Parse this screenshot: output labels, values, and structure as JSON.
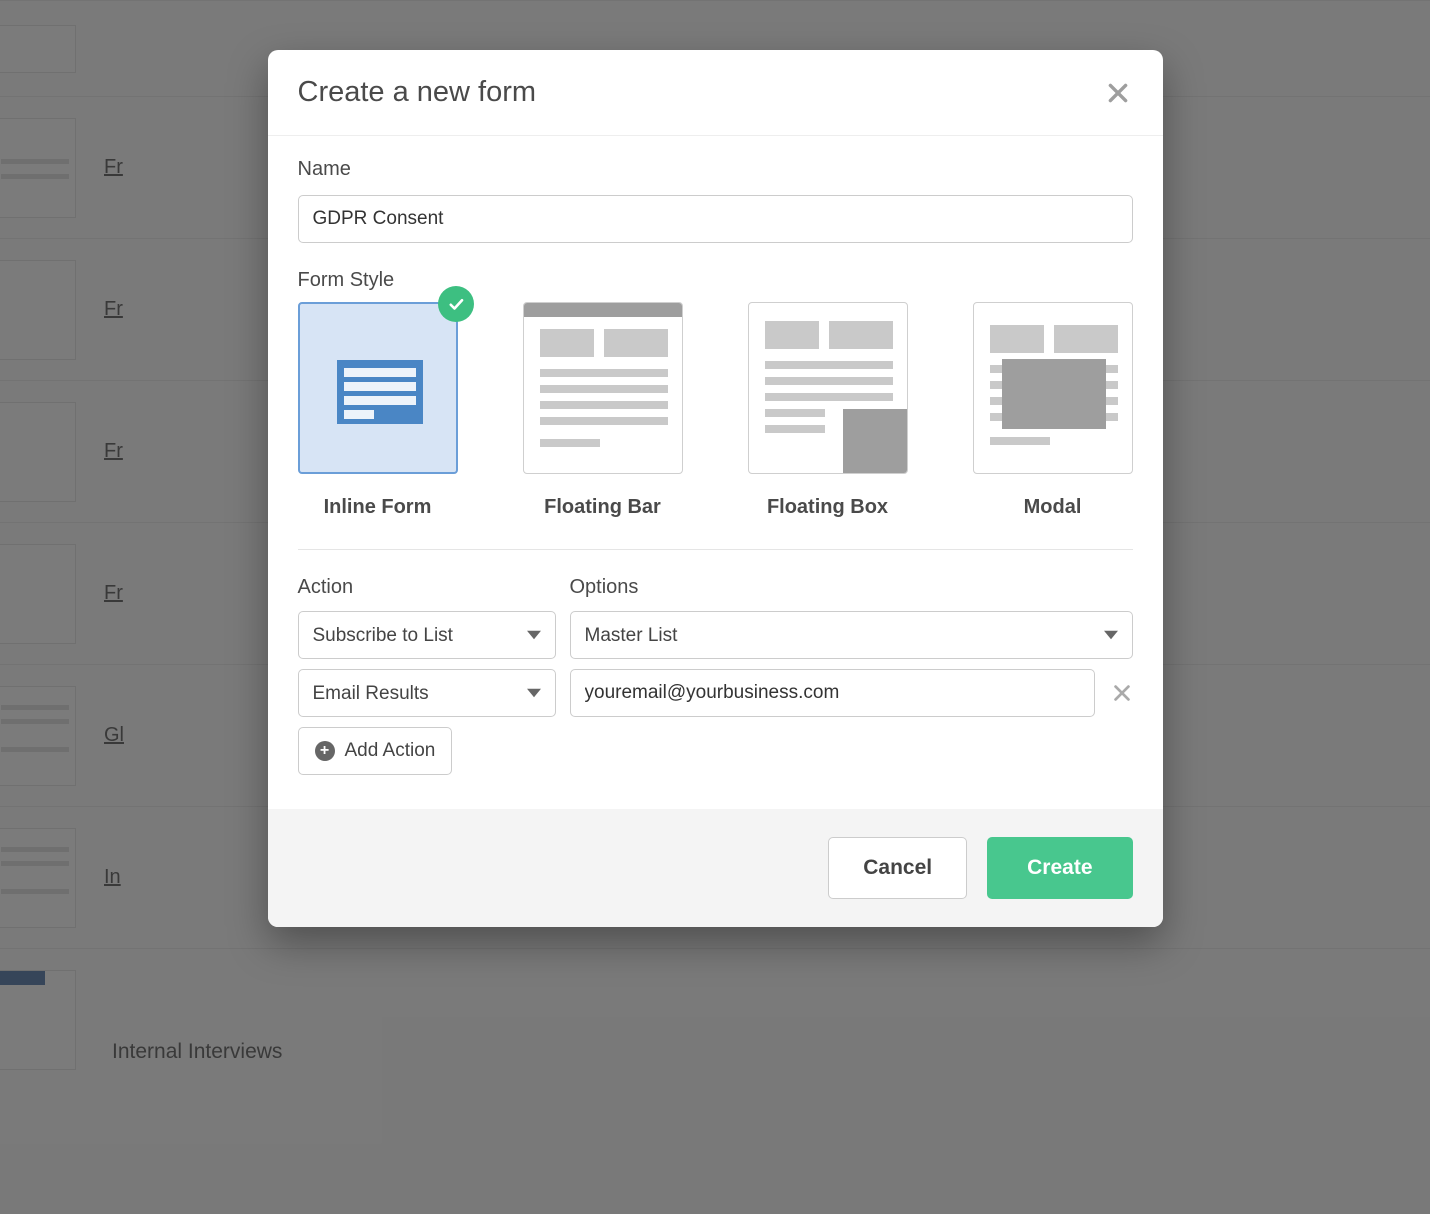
{
  "modal": {
    "title": "Create a new form",
    "nameLabel": "Name",
    "nameValue": "GDPR Consent",
    "styleLabel": "Form Style",
    "styles": [
      {
        "id": "inline",
        "label": "Inline Form",
        "selected": true
      },
      {
        "id": "floating-bar",
        "label": "Floating Bar",
        "selected": false
      },
      {
        "id": "floating-box",
        "label": "Floating Box",
        "selected": false
      },
      {
        "id": "modal",
        "label": "Modal",
        "selected": false
      }
    ],
    "actionLabel": "Action",
    "optionsLabel": "Options",
    "actions": [
      {
        "action": "Subscribe to List",
        "optionType": "select",
        "option": "Master List"
      },
      {
        "action": "Email Results",
        "optionType": "text",
        "option": "youremail@yourbusiness.com"
      }
    ],
    "addActionLabel": "Add Action",
    "footer": {
      "cancel": "Cancel",
      "create": "Create"
    }
  },
  "background": {
    "rows": [
      "Fr",
      "Fr",
      "Fr",
      "Fr",
      "Gl",
      "In"
    ],
    "lastLabel": "Internal Interviews"
  }
}
